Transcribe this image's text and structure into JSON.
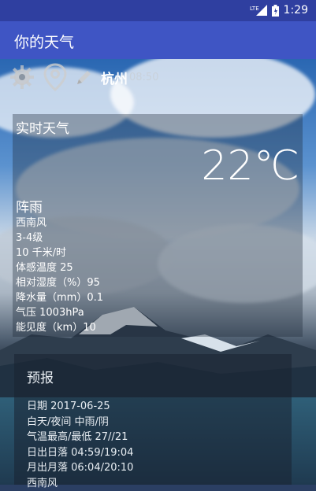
{
  "status_bar": {
    "time": "1:29",
    "network_label": "LTE",
    "icons": [
      "signal-icon",
      "battery-icon"
    ]
  },
  "app_bar": {
    "title": "你的天气"
  },
  "toolbar": {
    "city": "杭州",
    "time": "08:50",
    "icons": [
      "gear-icon",
      "location-pin-icon",
      "pencil-icon"
    ]
  },
  "realtime": {
    "heading": "实时天气",
    "temperature": "22℃",
    "condition": "阵雨",
    "details": [
      "西南风",
      "3-4级",
      "10 千米/时",
      "体感温度 25",
      "相对湿度（%）95",
      "降水量（mm）0.1",
      "气压 1003hPa",
      "能见度（km）10"
    ]
  },
  "forecast": {
    "heading": "预报",
    "items": [
      "日期 2017-06-25",
      "白天/夜间 中雨/阴",
      "气温最高/最低 27//21",
      "日出日落 04:59/19:04",
      "月出月落 06:04/20:10",
      "西南风"
    ]
  },
  "colors": {
    "status_bar": "#2f3fa0",
    "app_bar": "#3f55c4"
  }
}
